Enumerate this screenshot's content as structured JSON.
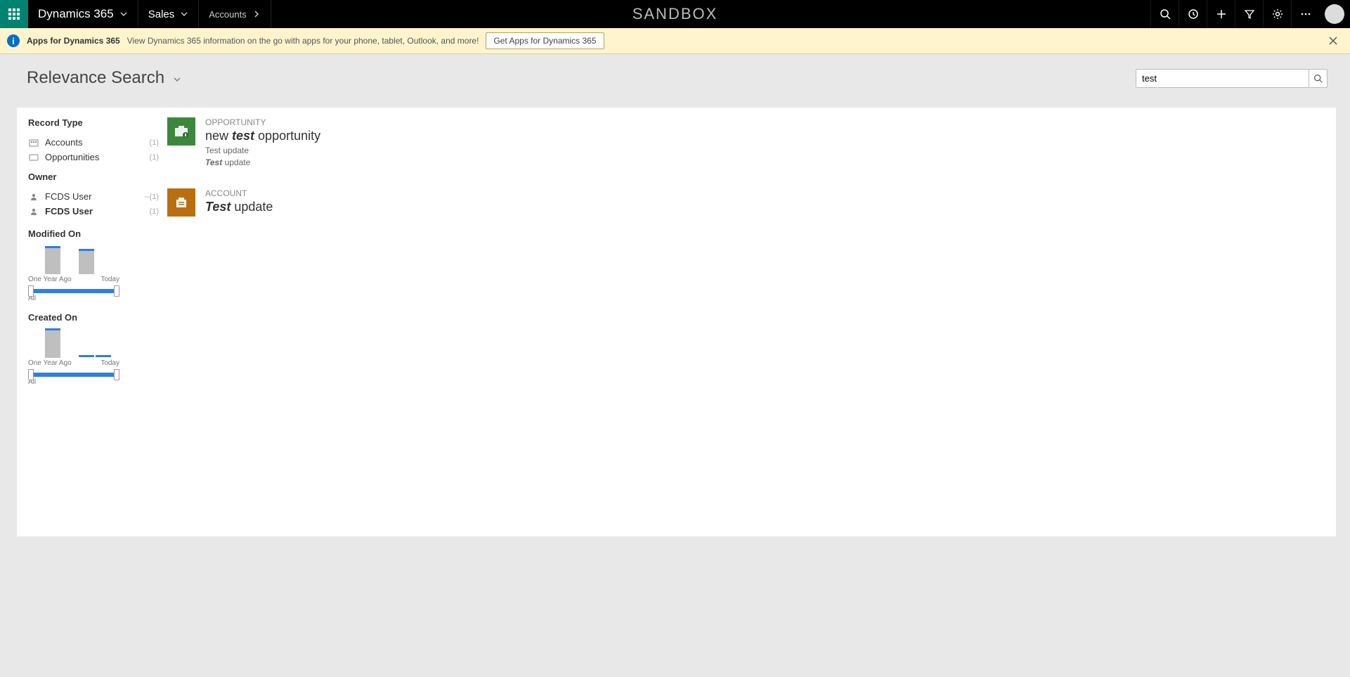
{
  "topbar": {
    "product": "Dynamics 365",
    "area": "Sales",
    "crumb": "Accounts",
    "sandbox": "SANDBOX"
  },
  "banner": {
    "title": "Apps for Dynamics 365",
    "desc": "View Dynamics 365 information on the go with apps for your phone, tablet, Outlook, and more!",
    "button": "Get Apps for Dynamics 365"
  },
  "search": {
    "heading": "Relevance Search",
    "value": "test"
  },
  "facets": {
    "recordType": {
      "heading": "Record Type",
      "items": [
        {
          "label": "Accounts",
          "count": "(1)",
          "icon": "building"
        },
        {
          "label": "Opportunities",
          "count": "(1)",
          "icon": "rect"
        }
      ]
    },
    "owner": {
      "heading": "Owner",
      "items": [
        {
          "label": "FCDS User",
          "count": "--(1)"
        },
        {
          "label": "FCDS User",
          "count": "(1)"
        }
      ]
    },
    "modified": {
      "heading": "Modified On",
      "startLabel": "One Year Ago",
      "endLabel": "Today",
      "all": "All"
    },
    "created": {
      "heading": "Created On",
      "startLabel": "One Year Ago",
      "endLabel": "Today",
      "all": "All"
    }
  },
  "results": [
    {
      "type": "OPPORTUNITY",
      "title_pre": "new ",
      "title_em": "test",
      "title_post": " opportunity",
      "meta1": "Test update",
      "meta2_em": "Test",
      "meta2_post": " update",
      "tile": "opp"
    },
    {
      "type": "ACCOUNT",
      "title_pre": "",
      "title_em": "Test",
      "title_post": " update",
      "tile": "acc"
    }
  ],
  "chart_data": [
    {
      "type": "bar",
      "title": "Modified On",
      "xlabel_start": "One Year Ago",
      "xlabel_end": "Today",
      "values": [
        40,
        0,
        36,
        0,
        0
      ],
      "note": "distribution histogram of record modification dates; bar heights approximate, no y-axis shown"
    },
    {
      "type": "bar",
      "title": "Created On",
      "xlabel_start": "One Year Ago",
      "xlabel_end": "Today",
      "values": [
        42,
        0,
        0,
        0,
        0
      ],
      "note": "distribution histogram of record creation dates; flat blue segments for empty buckets"
    }
  ]
}
